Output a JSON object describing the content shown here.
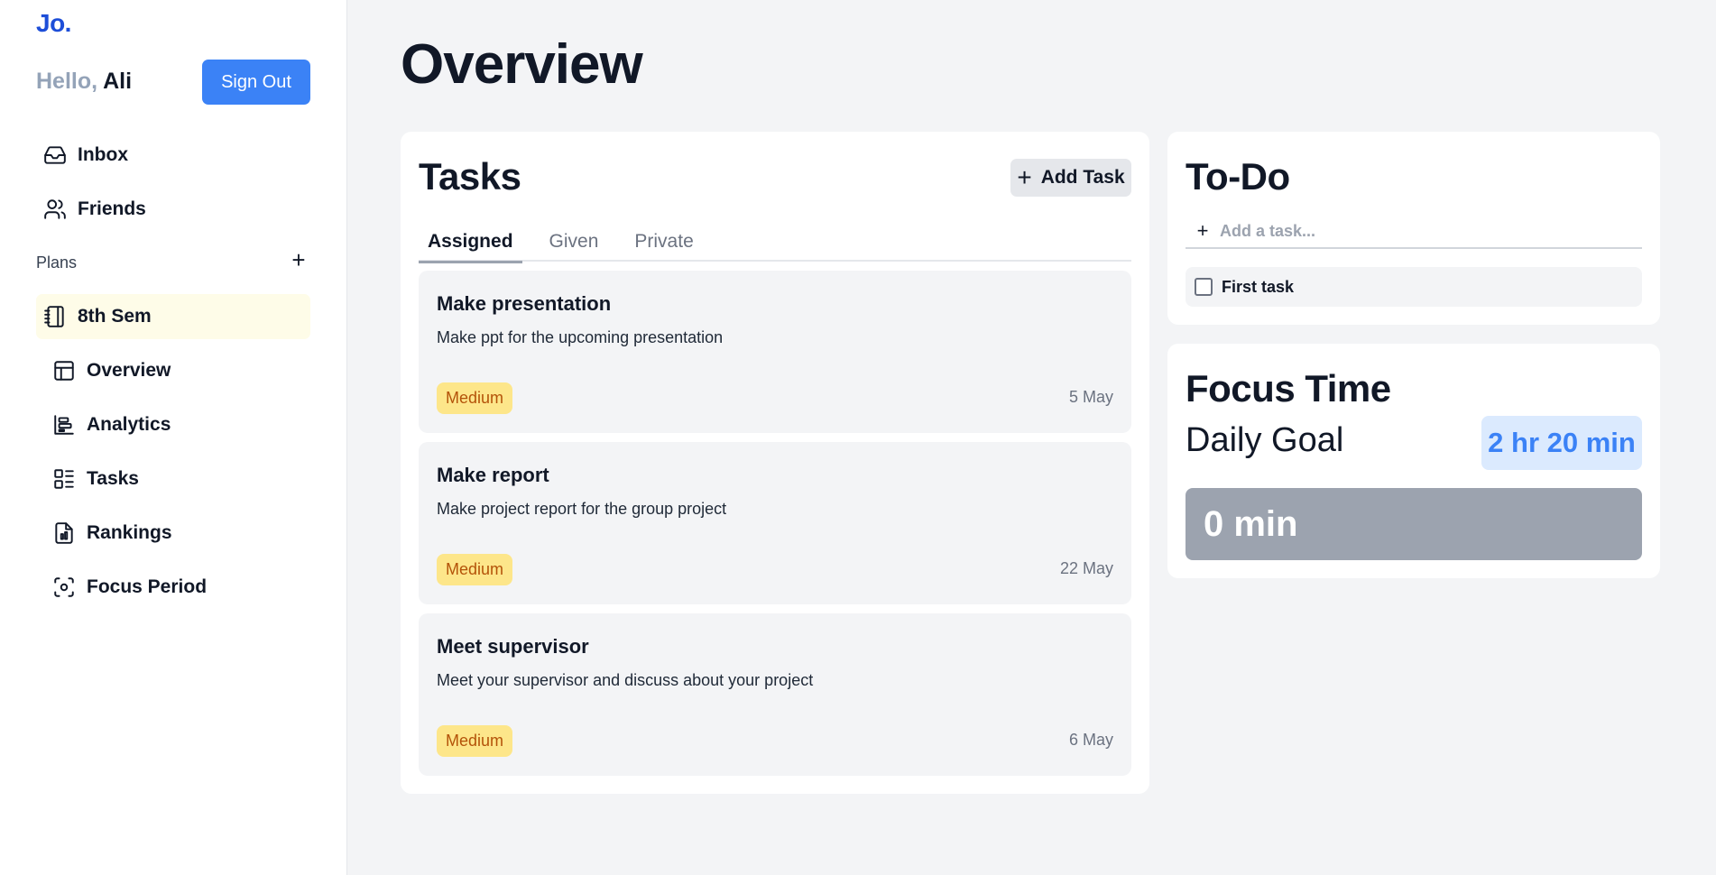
{
  "app": {
    "logo": "Jo."
  },
  "user": {
    "greeting": "Hello,",
    "name": "Ali",
    "sign_out_label": "Sign Out"
  },
  "sidebar": {
    "nav": [
      {
        "label": "Inbox",
        "icon": "inbox-icon"
      },
      {
        "label": "Friends",
        "icon": "users-icon"
      }
    ],
    "plans_label": "Plans",
    "plans_add": "+",
    "plan": {
      "label": "8th Sem",
      "icon": "notebook-icon"
    },
    "plan_items": [
      {
        "label": "Overview",
        "icon": "layout-icon"
      },
      {
        "label": "Analytics",
        "icon": "analytics-icon"
      },
      {
        "label": "Tasks",
        "icon": "list-icon"
      },
      {
        "label": "Rankings",
        "icon": "rankings-icon"
      },
      {
        "label": "Focus Period",
        "icon": "focus-icon"
      }
    ]
  },
  "main": {
    "title": "Overview"
  },
  "tasks": {
    "title": "Tasks",
    "add_label": "Add Task",
    "tabs": [
      "Assigned",
      "Given",
      "Private"
    ],
    "active_tab": "Assigned",
    "items": [
      {
        "title": "Make presentation",
        "desc": "Make ppt for the upcoming presentation",
        "priority": "Medium",
        "date": "5 May"
      },
      {
        "title": "Make report",
        "desc": "Make project report for the group project",
        "priority": "Medium",
        "date": "22 May"
      },
      {
        "title": "Meet supervisor",
        "desc": "Meet your supervisor and discuss about your project",
        "priority": "Medium",
        "date": "6 May"
      }
    ]
  },
  "todo": {
    "title": "To-Do",
    "input_placeholder": "Add a task...",
    "input_value": "",
    "items": [
      {
        "label": "First task",
        "checked": false
      }
    ]
  },
  "focus": {
    "title": "Focus Time",
    "goal_label": "Daily Goal",
    "goal_value": "2 hr 20 min",
    "progress_text": "0 min",
    "progress_fraction": 0
  },
  "colors": {
    "accent": "#3b82f6",
    "logo": "#1d4ed8",
    "badge_bg": "#fde68a",
    "badge_text": "#b45309",
    "active_plan_bg": "#fefce8"
  }
}
